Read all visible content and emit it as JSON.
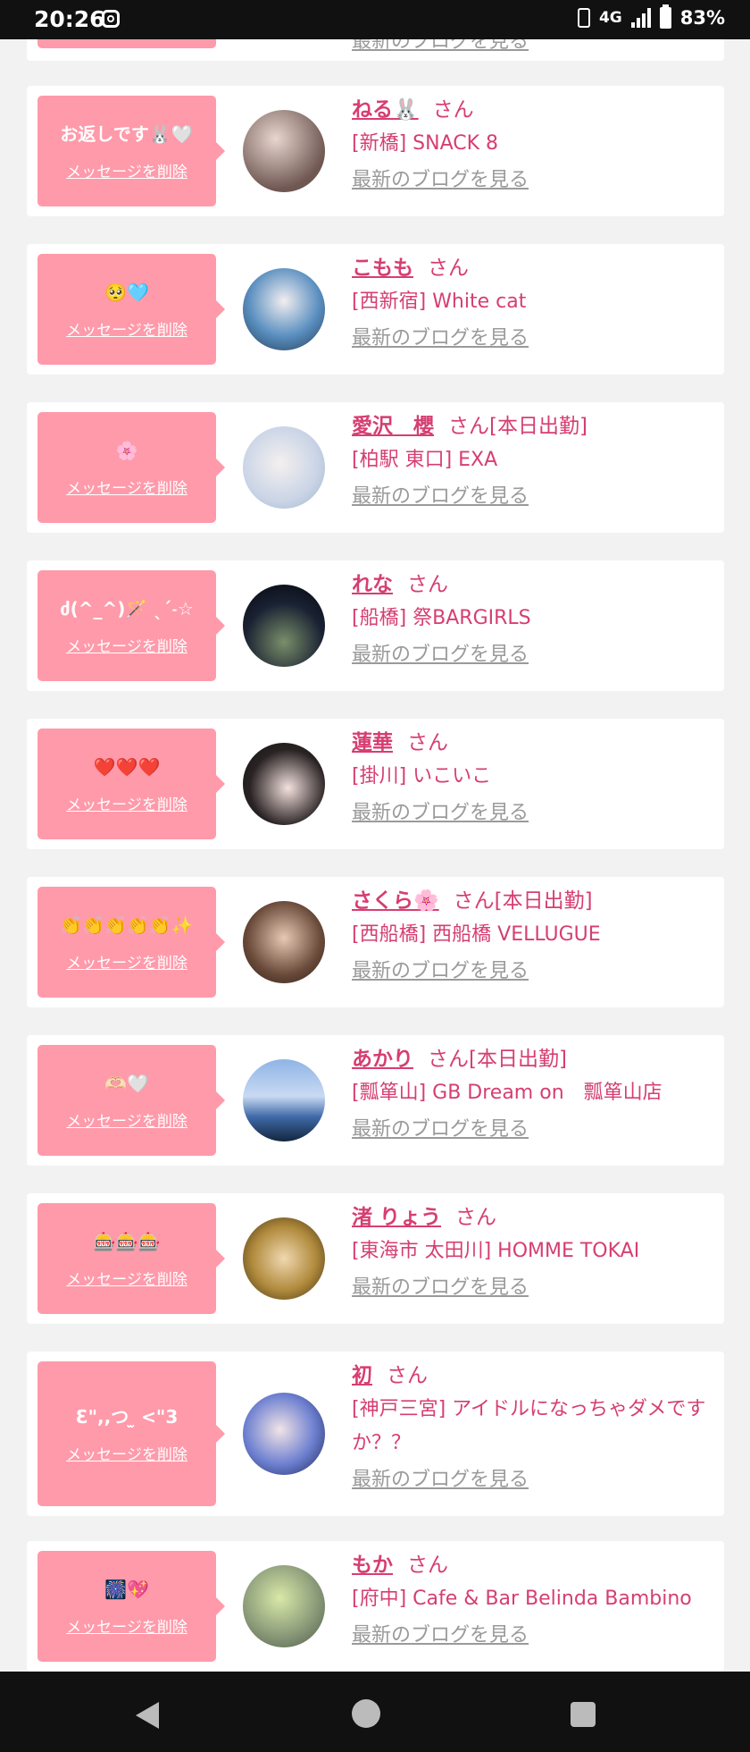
{
  "status_bar": {
    "time": "20:26",
    "network": "4G",
    "battery": "83%"
  },
  "top_partial": {
    "blog_link": "最新のブログを見る"
  },
  "entries": [
    {
      "message": "お返しです🐰🤍",
      "delete_label": "メッセージを削除",
      "name": "ねる🐰",
      "suffix": "さん",
      "shop": "[新橋] SNACK 8",
      "blog_link": "最新のブログを見る"
    },
    {
      "message": "🥺🩵",
      "delete_label": "メッセージを削除",
      "name": "こもも",
      "suffix": "さん",
      "shop": "[西新宿] White cat",
      "blog_link": "最新のブログを見る"
    },
    {
      "message": "🌸",
      "delete_label": "メッセージを削除",
      "name": "愛沢　櫻",
      "suffix": "さん[本日出勤]",
      "shop": "[柏駅 東口] EXA",
      "blog_link": "最新のブログを見る"
    },
    {
      "message": "ძ(^_^)🪄 ˎˊ˗☆",
      "delete_label": "メッセージを削除",
      "name": "れな",
      "suffix": "さん",
      "shop": "[船橋] 祭BARGIRLS",
      "blog_link": "最新のブログを見る"
    },
    {
      "message": "❤️❤️❤️",
      "delete_label": "メッセージを削除",
      "name": "蓮華",
      "suffix": "さん",
      "shop": "[掛川] いこいこ",
      "blog_link": "最新のブログを見る"
    },
    {
      "message": "👏👏👏👏👏✨",
      "delete_label": "メッセージを削除",
      "name": "さくら🌸",
      "suffix": "さん[本日出勤]",
      "shop": "[西船橋] 西船橋 VELLUGUE",
      "blog_link": "最新のブログを見る"
    },
    {
      "message": "🫶🏻🤍",
      "delete_label": "メッセージを削除",
      "name": "あかり",
      "suffix": "さん[本日出勤]",
      "shop": "[瓢箪山] GB Dream on　瓢箪山店",
      "blog_link": "最新のブログを見る"
    },
    {
      "message": "🎰🎰🎰",
      "delete_label": "メッセージを削除",
      "name": "渚 りょう",
      "suffix": "さん",
      "shop": "[東海市 太田川] HOMME TOKAI",
      "blog_link": "最新のブログを見る"
    },
    {
      "message": "Ɛ\",,つ ̫ <\"3",
      "delete_label": "メッセージを削除",
      "name": "初",
      "suffix": "さん",
      "shop": "[神戸三宮] アイドルになっちゃダメですか？？",
      "blog_link": "最新のブログを見る"
    },
    {
      "message": "🎆💖",
      "delete_label": "メッセージを削除",
      "name": "もか",
      "suffix": "さん",
      "shop": "[府中] Cafe & Bar Belinda Bambino",
      "blog_link": "最新のブログを見る"
    }
  ],
  "colors": {
    "accent_pink": "#d63e72",
    "bubble_pink": "#ff9aaa",
    "link_gray": "#9a9a9a",
    "page_bg": "#f2f2f2"
  }
}
